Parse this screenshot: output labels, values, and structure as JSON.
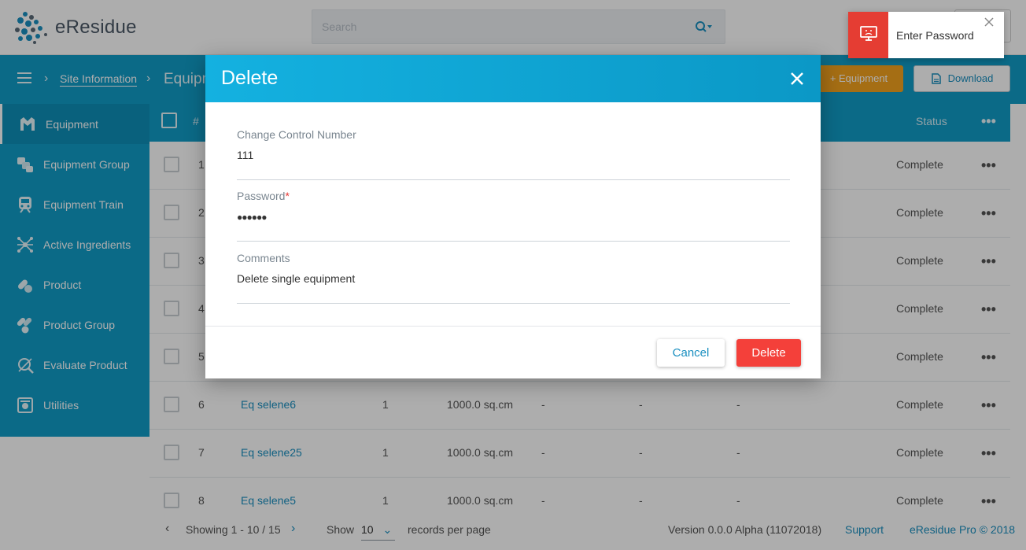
{
  "header": {
    "logo_text": "eResidue",
    "search_placeholder": "Search"
  },
  "toolbar": {
    "breadcrumb_link": "Site Information",
    "breadcrumb_current": "Equipment",
    "add_equipment_label": "+ Equipment",
    "download_label": "Download"
  },
  "sidebar": {
    "items": [
      {
        "label": "Equipment",
        "icon": "equipment-icon",
        "active": true
      },
      {
        "label": "Equipment Group",
        "icon": "equipment-group-icon"
      },
      {
        "label": "Equipment Train",
        "icon": "train-icon"
      },
      {
        "label": "Active Ingredients",
        "icon": "molecule-icon"
      },
      {
        "label": "Product",
        "icon": "capsule-icon"
      },
      {
        "label": "Product Group",
        "icon": "capsule-group-icon"
      },
      {
        "label": "Evaluate Product",
        "icon": "evaluate-icon"
      },
      {
        "label": "Utilities",
        "icon": "utilities-icon"
      }
    ]
  },
  "table": {
    "headers": {
      "index": "#",
      "status": "Status"
    },
    "rows": [
      {
        "num": "1",
        "status": "Complete"
      },
      {
        "num": "2",
        "status": "Complete"
      },
      {
        "num": "3",
        "status": "Complete"
      },
      {
        "num": "4",
        "status": "Complete"
      },
      {
        "num": "5",
        "status": "Complete"
      },
      {
        "num": "6",
        "name": "Eq selene6",
        "qty": "1",
        "area": "1000.0 sq.cm",
        "c1": "-",
        "c2": "-",
        "c3": "-",
        "status": "Complete"
      },
      {
        "num": "7",
        "name": "Eq selene25",
        "qty": "1",
        "area": "1000.0 sq.cm",
        "c1": "-",
        "c2": "-",
        "c3": "-",
        "status": "Complete"
      },
      {
        "num": "8",
        "name": "Eq selene5",
        "qty": "1",
        "area": "1000.0 sq.cm",
        "c1": "-",
        "c2": "-",
        "c3": "-",
        "status": "Complete"
      }
    ]
  },
  "footer": {
    "showing": "Showing 1 - 10 / 15",
    "show_label": "Show",
    "per_page_value": "10",
    "records_label": "records per page",
    "version": "Version 0.0.0 Alpha (11072018)",
    "support": "Support",
    "copyright": "eResidue Pro © 2018"
  },
  "modal": {
    "title": "Delete",
    "fields": [
      {
        "label": "Change Control Number",
        "value": "111"
      },
      {
        "label": "Password",
        "value": "●●●●●●",
        "required": "*"
      },
      {
        "label": "Comments",
        "value": "Delete single equipment"
      }
    ],
    "cancel_label": "Cancel",
    "delete_label": "Delete"
  },
  "toast": {
    "message": "Enter Password",
    "icon": "monitor-error-icon"
  },
  "colors": {
    "primary": "#119cc8",
    "accent_orange": "#f4a21e",
    "danger": "#f4403a",
    "toast_red": "#e53d33"
  }
}
